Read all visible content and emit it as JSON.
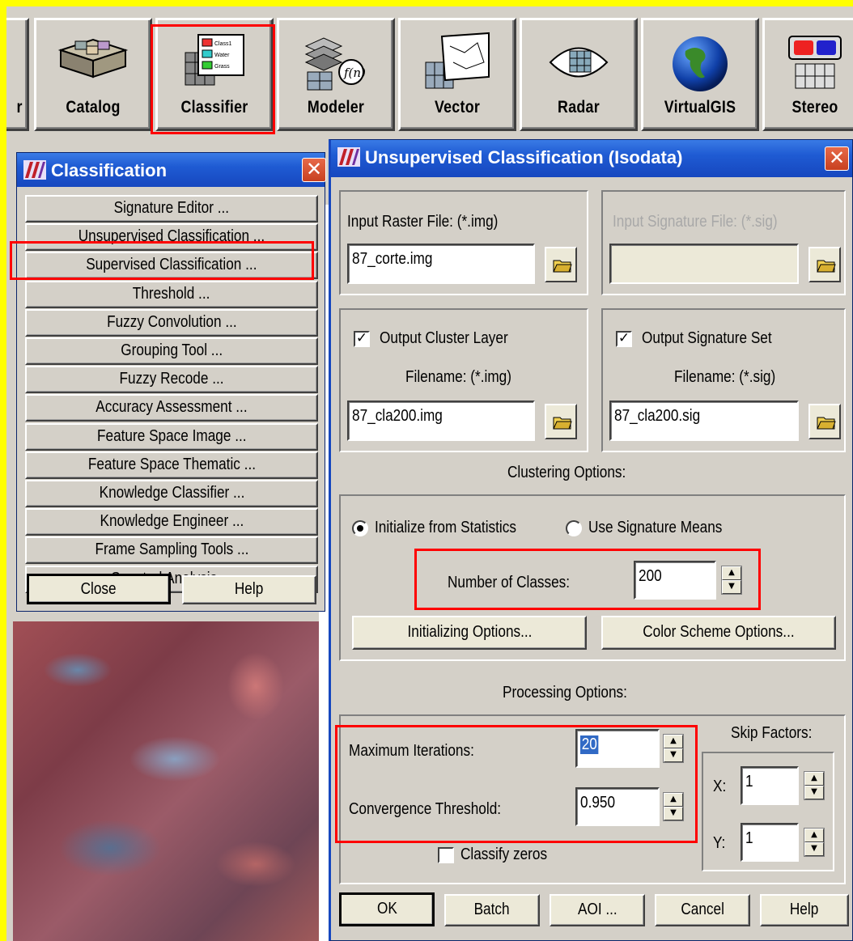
{
  "toolbar": {
    "items": [
      {
        "label": "r"
      },
      {
        "label": "Catalog"
      },
      {
        "label": "Classifier"
      },
      {
        "label": "Modeler"
      },
      {
        "label": "Vector"
      },
      {
        "label": "Radar"
      },
      {
        "label": "VirtualGIS"
      },
      {
        "label": "Stereo"
      }
    ],
    "classifier_icon_labels": [
      "Class1",
      "Water",
      "Grass"
    ]
  },
  "classification_window": {
    "title": "Classification",
    "close_glyph": "✕",
    "items": [
      "Signature Editor ...",
      "Unsupervised Classification ...",
      "Supervised Classification ...",
      "Threshold ...",
      "Fuzzy Convolution ...",
      "Grouping Tool ...",
      "Fuzzy Recode ...",
      "Accuracy Assessment ...",
      "Feature Space Image ...",
      "Feature Space Thematic ...",
      "Knowledge Classifier ...",
      "Knowledge Engineer ...",
      "Frame Sampling Tools ...",
      "Spectral Analysis ..."
    ],
    "close_label": "Close",
    "help_label": "Help"
  },
  "unsupervised_window": {
    "title": "Unsupervised Classification (Isodata)",
    "close_glyph": "✕",
    "input_raster_label": "Input Raster File: (*.img)",
    "input_raster_value": "87_corte.img",
    "input_signature_label": "Input Signature File: (*.sig)",
    "input_signature_value": "",
    "output_cluster_layer_label": "Output Cluster Layer",
    "output_cluster_layer_checked": true,
    "output_cluster_filename_label": "Filename: (*.img)",
    "output_cluster_filename_value": "87_cla200.img",
    "output_signature_set_label": "Output Signature Set",
    "output_signature_set_checked": true,
    "output_signature_filename_label": "Filename: (*.sig)",
    "output_signature_filename_value": "87_cla200.sig",
    "clustering_options_label": "Clustering Options:",
    "init_from_statistics_label": "Initialize from Statistics",
    "use_signature_means_label": "Use Signature Means",
    "init_selected": "Initialize from Statistics",
    "number_of_classes_label": "Number of Classes:",
    "number_of_classes_value": "200",
    "initializing_options_label": "Initializing Options...",
    "color_scheme_options_label": "Color Scheme Options...",
    "processing_options_label": "Processing Options:",
    "maximum_iterations_label": "Maximum Iterations:",
    "maximum_iterations_value": "20",
    "convergence_threshold_label": "Convergence Threshold:",
    "convergence_threshold_value": "0.950",
    "skip_factors_label": "Skip Factors:",
    "skip_x_label": "X:",
    "skip_x_value": "1",
    "skip_y_label": "Y:",
    "skip_y_value": "1",
    "classify_zeros_label": "Classify zeros",
    "classify_zeros_checked": false,
    "buttons": {
      "ok": "OK",
      "batch": "Batch",
      "aoi": "AOI ...",
      "cancel": "Cancel",
      "help": "Help"
    }
  },
  "colors": {
    "frame_yellow": "#ffff00",
    "highlight_red": "#ff0000",
    "titlebar_blue": "#1f5bd3",
    "dialog_face": "#ece9d8"
  }
}
